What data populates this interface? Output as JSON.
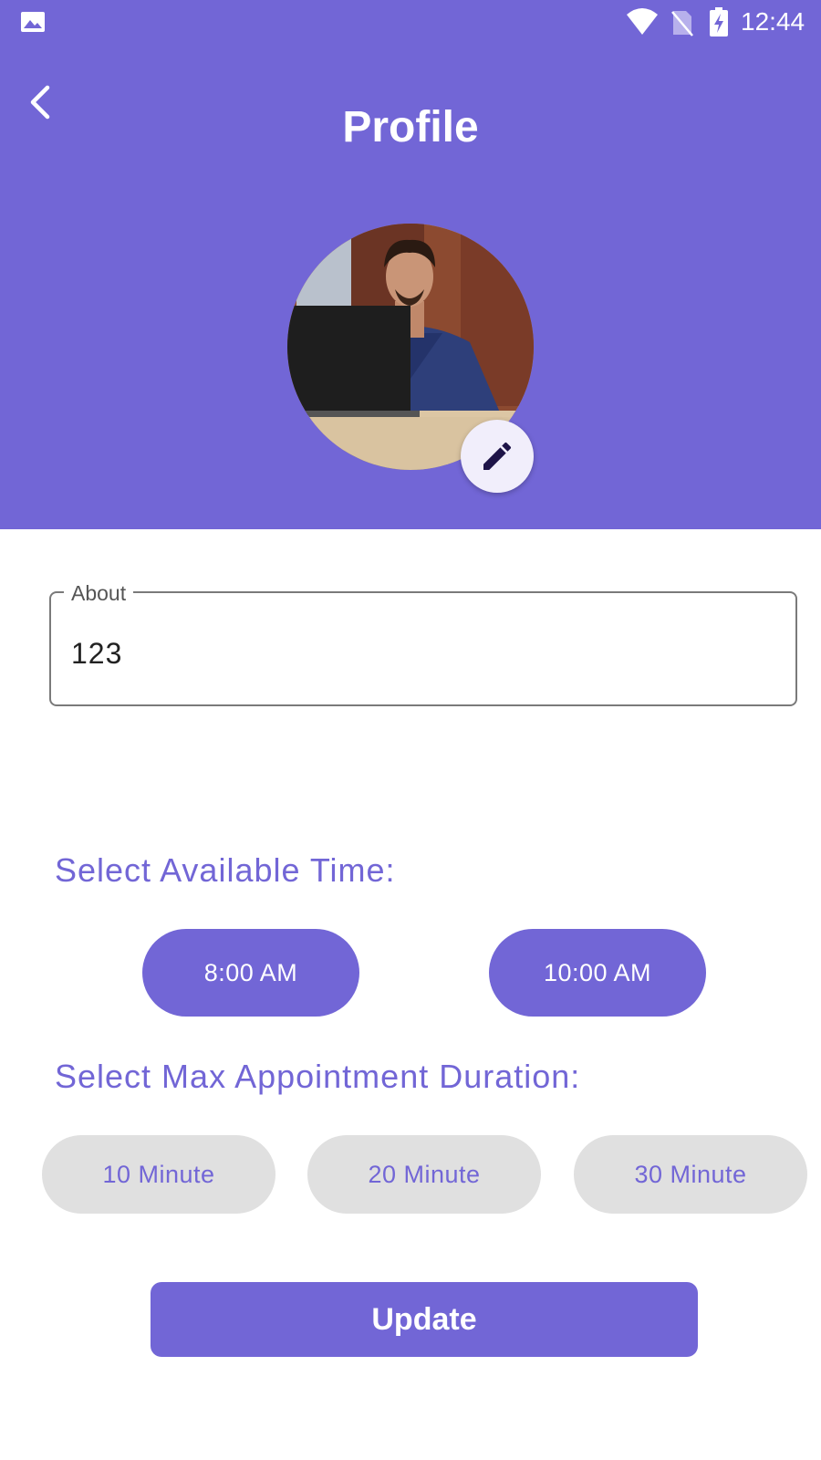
{
  "status_bar": {
    "time": "12:44",
    "icons": [
      "gallery-icon",
      "wifi-icon",
      "no-sim-icon",
      "battery-charging-icon"
    ]
  },
  "app_bar": {
    "title": "Profile",
    "back_icon": "chevron-left-icon"
  },
  "profile": {
    "avatar": "profile-photo",
    "edit_icon": "pencil-icon"
  },
  "about": {
    "label": "About",
    "value": "123"
  },
  "available_time": {
    "heading": "Select Available Time:",
    "start": "8:00 AM",
    "end": "10:00 AM"
  },
  "duration": {
    "heading": "Select Max Appointment Duration:",
    "options": [
      "10 Minute",
      "20 Minute",
      "30 Minute"
    ]
  },
  "update_button": {
    "label": "Update"
  },
  "colors": {
    "primary": "#7266d6",
    "chip_bg": "#e0e0e0",
    "edit_button_bg": "#f1eefb",
    "background": "#ffffff"
  }
}
